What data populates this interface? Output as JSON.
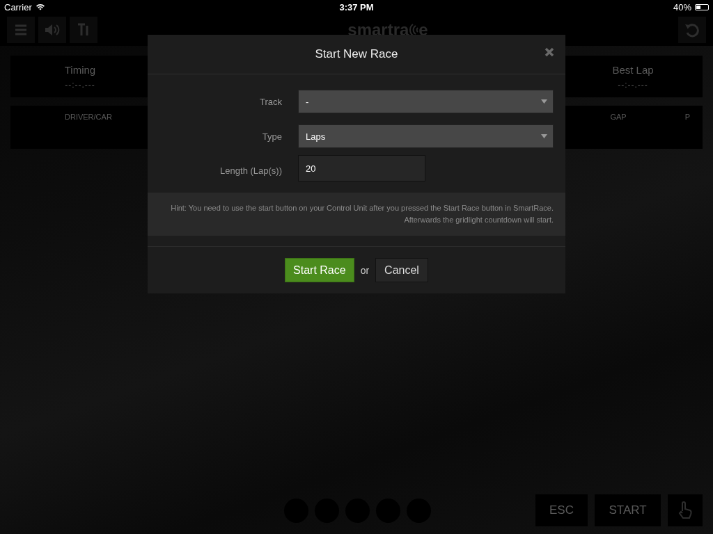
{
  "status_bar": {
    "carrier": "Carrier",
    "time": "3:37 PM",
    "battery": "40%"
  },
  "toolbar": {
    "logo_start": "smartra",
    "logo_end": "e"
  },
  "panels": [
    {
      "title": "Timing",
      "value": "--:--.---"
    },
    {
      "title": "Best Lap",
      "value": "--:--.---"
    }
  ],
  "columns": [
    "DRIVER/CAR",
    "GAP",
    "P"
  ],
  "dialog": {
    "title": "Start New Race",
    "fields": [
      {
        "label": "Track",
        "kind": "select",
        "value": "-"
      },
      {
        "label": "Type",
        "kind": "select",
        "value": "Laps"
      },
      {
        "label": "Length (Lap(s))",
        "kind": "input",
        "value": "20"
      }
    ],
    "hint": "Hint: You need to use the start button on your Control Unit after you pressed the Start Race button in SmartRace. Afterwards the gridlight countdown will start.",
    "primary_button": "Start Race",
    "separator": "or",
    "cancel_button": "Cancel"
  },
  "controls": [
    "ESC",
    "START"
  ]
}
